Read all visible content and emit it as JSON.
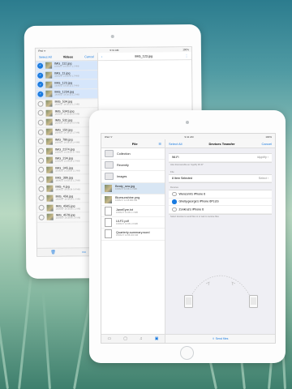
{
  "back_tablet": {
    "status": {
      "left": "iPad ᯤ",
      "center": "9:41 AM",
      "right": "100%"
    },
    "left_nav": {
      "select_all": "Select All",
      "title": "Videos",
      "cancel": "Cancel"
    },
    "right_nav": {
      "title": "IMG_123.jpg",
      "more": "⋮"
    },
    "rows": [
      {
        "name": "IMG_112.jpg",
        "meta": "16/06/17 14:38:07  1.5 MiB",
        "selected": true
      },
      {
        "name": "IMG_11.jpg",
        "meta": "16/06/17 14:38:09  1.0 MiB",
        "selected": true
      },
      {
        "name": "IMG_123.jpg",
        "meta": "16/06/17 14:38:11  2.0 MiB",
        "selected": true
      },
      {
        "name": "IMG_1234.jpg",
        "meta": "16/06/17 14:38:13  1.2 MiB",
        "selected": true
      },
      {
        "name": "IMG_534.jpg",
        "meta": "16/06/17 14:38:15  1.1 MiB",
        "selected": false
      },
      {
        "name": "IMG_5343.jpg",
        "meta": "16/06/17 14:38:18  1.6 MiB",
        "selected": false
      },
      {
        "name": "IMG_532.jpg",
        "meta": "16/06/17 14:38:20  0.9 MiB",
        "selected": false
      },
      {
        "name": "IMG_150.jpg",
        "meta": "16/06/17 14:38:22  1.3 MiB",
        "selected": false
      },
      {
        "name": "IMG_786.jpg",
        "meta": "16/06/17 14:38:24  1.4 MiB",
        "selected": false
      },
      {
        "name": "IMG_2374.jpg",
        "meta": "16/06/17 14:38:26  1.7 MiB",
        "selected": false
      },
      {
        "name": "IMG_234.jpg",
        "meta": "16/06/17 14:38:28  1.0 MiB",
        "selected": false
      },
      {
        "name": "IMG_345.jpg",
        "meta": "16/06/17 14:38:30  2.1 MiB",
        "selected": false
      },
      {
        "name": "IMG_386.jpg",
        "meta": "16/06/17 14:38:32  1.2 MiB",
        "selected": false
      },
      {
        "name": "IMG_4.jpg",
        "meta": "16/06/17 14:38:34  0.8 MiB",
        "selected": false
      },
      {
        "name": "IMG_456.jpg",
        "meta": "16/06/17 14:38:36  1.5 MiB",
        "selected": false
      },
      {
        "name": "IMG_4565.jpg",
        "meta": "16/06/17 14:38:38  1.1 MiB",
        "selected": false
      },
      {
        "name": "IMG_4578.jpg",
        "meta": "16/06/17 14:38:40  1.9 MiB",
        "selected": false
      }
    ]
  },
  "front_tablet": {
    "status": {
      "left": "iPad ᯤ",
      "center": "9:41 AM",
      "right": "100%"
    },
    "left_nav": {
      "title": "File",
      "menu": "☰"
    },
    "files": [
      {
        "name": "Collection",
        "meta": "",
        "kind": "folder"
      },
      {
        "name": "Recently",
        "meta": "",
        "kind": "folder"
      },
      {
        "name": "Images",
        "meta": "",
        "kind": "folder"
      },
      {
        "name": "Beaty_sea.jpg",
        "meta": "16/06/17 14:38  1.2 MiB",
        "kind": "image"
      },
      {
        "name": "Bluesunshine.png",
        "meta": "16/06/17 14:38  880 KiB",
        "kind": "image"
      },
      {
        "name": "JaneEyre.txt",
        "meta": "16/06/17 14:38  1.1 MiB",
        "kind": "doc"
      },
      {
        "name": "ULF2.pdf",
        "meta": "16/06/17 14:38  1.8 MiB",
        "kind": "doc"
      },
      {
        "name": "Quarterly-summary.word",
        "meta": "16/06/17 14:38  300 KiB",
        "kind": "doc"
      }
    ],
    "bottom_icons": [
      "▭",
      "▢",
      "♫",
      "▣"
    ],
    "right_nav": {
      "select_all": "Select All",
      "title": "Devices Transfer",
      "cancel": "Cancel"
    },
    "wifi": {
      "label": "Wi-Fi",
      "value": "iApplify",
      "note": "Also discoverable as \"Applify Wi-Fi\""
    },
    "file_section": {
      "header": "File",
      "label": "8 Item Selected",
      "action": "Select"
    },
    "devices_header": "Devices",
    "devices": [
      {
        "name": "Wenzomi's iPhone 6",
        "on": false
      },
      {
        "name": "Ghelly.george's iPhone 6PLUS",
        "on": true
      },
      {
        "name": "Zonkrus's iPhone 6",
        "on": false
      }
    ],
    "devices_note": "Select devices to send files to or wait to receive files",
    "send_label": "Send files"
  }
}
